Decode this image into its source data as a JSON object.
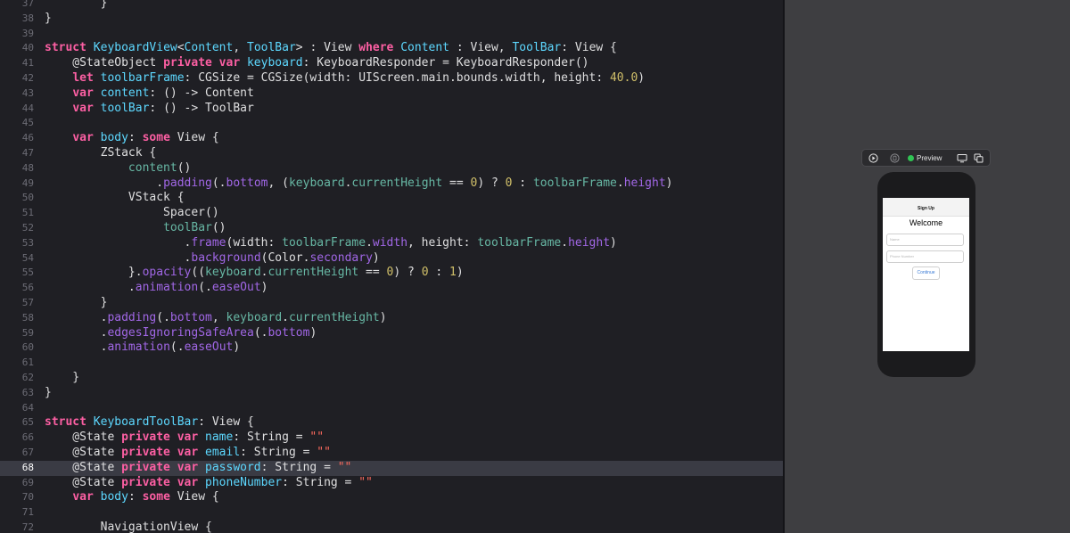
{
  "code_lines": [
    {
      "n": "37",
      "tokens": [
        {
          "t": "        }",
          "c": "pl"
        }
      ]
    },
    {
      "n": "38",
      "tokens": [
        {
          "t": "}",
          "c": "pl"
        }
      ]
    },
    {
      "n": "39",
      "tokens": []
    },
    {
      "n": "40",
      "tokens": [
        {
          "t": "struct ",
          "c": "kw"
        },
        {
          "t": "KeyboardView",
          "c": "ty"
        },
        {
          "t": "<",
          "c": "pl"
        },
        {
          "t": "Content",
          "c": "ty"
        },
        {
          "t": ", ",
          "c": "pl"
        },
        {
          "t": "ToolBar",
          "c": "ty"
        },
        {
          "t": "> : View ",
          "c": "pl"
        },
        {
          "t": "where ",
          "c": "kw"
        },
        {
          "t": "Content",
          "c": "ty"
        },
        {
          "t": " : View, ",
          "c": "pl"
        },
        {
          "t": "ToolBar",
          "c": "ty"
        },
        {
          "t": ": View {",
          "c": "pl"
        }
      ]
    },
    {
      "n": "41",
      "tokens": [
        {
          "t": "    @StateObject ",
          "c": "at"
        },
        {
          "t": "private var ",
          "c": "kw"
        },
        {
          "t": "keyboard",
          "c": "ty"
        },
        {
          "t": ": KeyboardResponder = KeyboardResponder()",
          "c": "pl"
        }
      ]
    },
    {
      "n": "42",
      "tokens": [
        {
          "t": "    ",
          "c": "pl"
        },
        {
          "t": "let ",
          "c": "kw"
        },
        {
          "t": "toolbarFrame",
          "c": "ty"
        },
        {
          "t": ": CGSize = CGSize(width: UIScreen.main.bounds.width, height: ",
          "c": "pl"
        },
        {
          "t": "40.0",
          "c": "nu"
        },
        {
          "t": ")",
          "c": "pl"
        }
      ]
    },
    {
      "n": "43",
      "tokens": [
        {
          "t": "    ",
          "c": "pl"
        },
        {
          "t": "var ",
          "c": "kw"
        },
        {
          "t": "content",
          "c": "ty"
        },
        {
          "t": ": () -> Content",
          "c": "pl"
        }
      ]
    },
    {
      "n": "44",
      "tokens": [
        {
          "t": "    ",
          "c": "pl"
        },
        {
          "t": "var ",
          "c": "kw"
        },
        {
          "t": "toolBar",
          "c": "ty"
        },
        {
          "t": ": () -> ToolBar",
          "c": "pl"
        }
      ]
    },
    {
      "n": "45",
      "tokens": []
    },
    {
      "n": "46",
      "tokens": [
        {
          "t": "    ",
          "c": "pl"
        },
        {
          "t": "var ",
          "c": "kw"
        },
        {
          "t": "body",
          "c": "ty"
        },
        {
          "t": ": ",
          "c": "pl"
        },
        {
          "t": "some ",
          "c": "kw"
        },
        {
          "t": "View {",
          "c": "pl"
        }
      ]
    },
    {
      "n": "47",
      "tokens": [
        {
          "t": "        ZStack {",
          "c": "pl"
        }
      ]
    },
    {
      "n": "48",
      "tokens": [
        {
          "t": "            ",
          "c": "pl"
        },
        {
          "t": "content",
          "c": "fn"
        },
        {
          "t": "()",
          "c": "pl"
        }
      ]
    },
    {
      "n": "49",
      "tokens": [
        {
          "t": "                .",
          "c": "pl"
        },
        {
          "t": "padding",
          "c": "pr"
        },
        {
          "t": "(.",
          "c": "pl"
        },
        {
          "t": "bottom",
          "c": "pr"
        },
        {
          "t": ", (",
          "c": "pl"
        },
        {
          "t": "keyboard",
          "c": "fn"
        },
        {
          "t": ".",
          "c": "pl"
        },
        {
          "t": "currentHeight",
          "c": "fn"
        },
        {
          "t": " == ",
          "c": "pl"
        },
        {
          "t": "0",
          "c": "nu"
        },
        {
          "t": ") ? ",
          "c": "pl"
        },
        {
          "t": "0",
          "c": "nu"
        },
        {
          "t": " : ",
          "c": "pl"
        },
        {
          "t": "toolbarFrame",
          "c": "fn"
        },
        {
          "t": ".",
          "c": "pl"
        },
        {
          "t": "height",
          "c": "pr"
        },
        {
          "t": ")",
          "c": "pl"
        }
      ]
    },
    {
      "n": "50",
      "tokens": [
        {
          "t": "            VStack {",
          "c": "pl"
        }
      ]
    },
    {
      "n": "51",
      "tokens": [
        {
          "t": "                 Spacer()",
          "c": "pl"
        }
      ]
    },
    {
      "n": "52",
      "tokens": [
        {
          "t": "                 ",
          "c": "pl"
        },
        {
          "t": "toolBar",
          "c": "fn"
        },
        {
          "t": "()",
          "c": "pl"
        }
      ]
    },
    {
      "n": "53",
      "tokens": [
        {
          "t": "                    .",
          "c": "pl"
        },
        {
          "t": "frame",
          "c": "pr"
        },
        {
          "t": "(width: ",
          "c": "pl"
        },
        {
          "t": "toolbarFrame",
          "c": "fn"
        },
        {
          "t": ".",
          "c": "pl"
        },
        {
          "t": "width",
          "c": "pr"
        },
        {
          "t": ", height: ",
          "c": "pl"
        },
        {
          "t": "toolbarFrame",
          "c": "fn"
        },
        {
          "t": ".",
          "c": "pl"
        },
        {
          "t": "height",
          "c": "pr"
        },
        {
          "t": ")",
          "c": "pl"
        }
      ]
    },
    {
      "n": "54",
      "tokens": [
        {
          "t": "                    .",
          "c": "pl"
        },
        {
          "t": "background",
          "c": "pr"
        },
        {
          "t": "(Color.",
          "c": "pl"
        },
        {
          "t": "secondary",
          "c": "pr"
        },
        {
          "t": ")",
          "c": "pl"
        }
      ]
    },
    {
      "n": "55",
      "tokens": [
        {
          "t": "            }.",
          "c": "pl"
        },
        {
          "t": "opacity",
          "c": "pr"
        },
        {
          "t": "((",
          "c": "pl"
        },
        {
          "t": "keyboard",
          "c": "fn"
        },
        {
          "t": ".",
          "c": "pl"
        },
        {
          "t": "currentHeight",
          "c": "fn"
        },
        {
          "t": " == ",
          "c": "pl"
        },
        {
          "t": "0",
          "c": "nu"
        },
        {
          "t": ") ? ",
          "c": "pl"
        },
        {
          "t": "0",
          "c": "nu"
        },
        {
          "t": " : ",
          "c": "pl"
        },
        {
          "t": "1",
          "c": "nu"
        },
        {
          "t": ")",
          "c": "pl"
        }
      ]
    },
    {
      "n": "56",
      "tokens": [
        {
          "t": "            .",
          "c": "pl"
        },
        {
          "t": "animation",
          "c": "pr"
        },
        {
          "t": "(.",
          "c": "pl"
        },
        {
          "t": "easeOut",
          "c": "pr"
        },
        {
          "t": ")",
          "c": "pl"
        }
      ]
    },
    {
      "n": "57",
      "tokens": [
        {
          "t": "        }",
          "c": "pl"
        }
      ]
    },
    {
      "n": "58",
      "tokens": [
        {
          "t": "        .",
          "c": "pl"
        },
        {
          "t": "padding",
          "c": "pr"
        },
        {
          "t": "(.",
          "c": "pl"
        },
        {
          "t": "bottom",
          "c": "pr"
        },
        {
          "t": ", ",
          "c": "pl"
        },
        {
          "t": "keyboard",
          "c": "fn"
        },
        {
          "t": ".",
          "c": "pl"
        },
        {
          "t": "currentHeight",
          "c": "fn"
        },
        {
          "t": ")",
          "c": "pl"
        }
      ]
    },
    {
      "n": "59",
      "tokens": [
        {
          "t": "        .",
          "c": "pl"
        },
        {
          "t": "edgesIgnoringSafeArea",
          "c": "pr"
        },
        {
          "t": "(.",
          "c": "pl"
        },
        {
          "t": "bottom",
          "c": "pr"
        },
        {
          "t": ")",
          "c": "pl"
        }
      ]
    },
    {
      "n": "60",
      "tokens": [
        {
          "t": "        .",
          "c": "pl"
        },
        {
          "t": "animation",
          "c": "pr"
        },
        {
          "t": "(.",
          "c": "pl"
        },
        {
          "t": "easeOut",
          "c": "pr"
        },
        {
          "t": ")",
          "c": "pl"
        }
      ]
    },
    {
      "n": "61",
      "tokens": []
    },
    {
      "n": "62",
      "tokens": [
        {
          "t": "    }",
          "c": "pl"
        }
      ]
    },
    {
      "n": "63",
      "tokens": [
        {
          "t": "}",
          "c": "pl"
        }
      ]
    },
    {
      "n": "64",
      "tokens": []
    },
    {
      "n": "65",
      "tokens": [
        {
          "t": "struct ",
          "c": "kw"
        },
        {
          "t": "KeyboardToolBar",
          "c": "ty"
        },
        {
          "t": ": View {",
          "c": "pl"
        }
      ]
    },
    {
      "n": "66",
      "tokens": [
        {
          "t": "    @State ",
          "c": "at"
        },
        {
          "t": "private var ",
          "c": "kw"
        },
        {
          "t": "name",
          "c": "ty"
        },
        {
          "t": ": String = ",
          "c": "pl"
        },
        {
          "t": "\"\"",
          "c": "st"
        }
      ]
    },
    {
      "n": "67",
      "tokens": [
        {
          "t": "    @State ",
          "c": "at"
        },
        {
          "t": "private var ",
          "c": "kw"
        },
        {
          "t": "email",
          "c": "ty"
        },
        {
          "t": ": String = ",
          "c": "pl"
        },
        {
          "t": "\"\"",
          "c": "st"
        }
      ]
    },
    {
      "n": "68",
      "current": true,
      "tokens": [
        {
          "t": "    @State ",
          "c": "at"
        },
        {
          "t": "private var ",
          "c": "kw"
        },
        {
          "t": "password",
          "c": "ty"
        },
        {
          "t": ": String = ",
          "c": "pl"
        },
        {
          "t": "\"\"",
          "c": "st"
        }
      ]
    },
    {
      "n": "69",
      "tokens": [
        {
          "t": "    @State ",
          "c": "at"
        },
        {
          "t": "private var ",
          "c": "kw"
        },
        {
          "t": "phoneNumber",
          "c": "ty"
        },
        {
          "t": ": String = ",
          "c": "pl"
        },
        {
          "t": "\"\"",
          "c": "st"
        }
      ]
    },
    {
      "n": "70",
      "tokens": [
        {
          "t": "    ",
          "c": "pl"
        },
        {
          "t": "var ",
          "c": "kw"
        },
        {
          "t": "body",
          "c": "ty"
        },
        {
          "t": ": ",
          "c": "pl"
        },
        {
          "t": "some ",
          "c": "kw"
        },
        {
          "t": "View {",
          "c": "pl"
        }
      ]
    },
    {
      "n": "71",
      "tokens": []
    },
    {
      "n": "72",
      "tokens": [
        {
          "t": "        NavigationView {",
          "c": "pl"
        }
      ]
    }
  ],
  "preview_toolbar": {
    "label": "Preview",
    "status_color": "#30c454"
  },
  "preview": {
    "nav_title": "Sign Up",
    "welcome": "Welcome",
    "name_placeholder": "Name",
    "phone_placeholder": "Phone Number",
    "continue_label": "Continue"
  }
}
